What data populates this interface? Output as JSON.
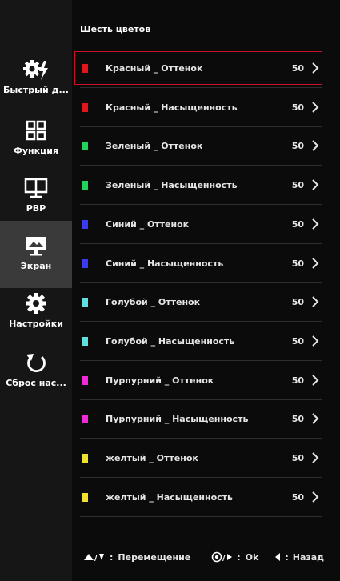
{
  "sidebar": {
    "items": [
      {
        "label": "Быстрый д...",
        "icon": "quick-settings-gear-bolt-icon"
      },
      {
        "label": "Функция",
        "icon": "grid-function-icon"
      },
      {
        "label": "PBP",
        "icon": "pbp-monitor-icon"
      },
      {
        "label": "Экран",
        "icon": "screen-monitor-icon",
        "active": true
      },
      {
        "label": "Настройки",
        "icon": "gear-icon"
      },
      {
        "label": "Сброс нас...",
        "icon": "reset-arrow-icon"
      }
    ]
  },
  "main": {
    "title": "Шесть цветов",
    "rows": [
      {
        "name": "Красный _ Оттенок",
        "value": "50",
        "color": "#e0161c",
        "selected": true
      },
      {
        "name": "Красный _ Насыщенность",
        "value": "50",
        "color": "#e0161c"
      },
      {
        "name": "Зеленый _ Оттенок",
        "value": "50",
        "color": "#22d35a"
      },
      {
        "name": "Зеленый _ Насыщенность",
        "value": "50",
        "color": "#22d35a"
      },
      {
        "name": "Синий _ Оттенок",
        "value": "50",
        "color": "#3b3bf0"
      },
      {
        "name": "Синий _ Насыщенность",
        "value": "50",
        "color": "#3b3bf0"
      },
      {
        "name": "Голубой _ Оттенок",
        "value": "50",
        "color": "#5fe0e0"
      },
      {
        "name": "Голубой _ Насыщенность",
        "value": "50",
        "color": "#5fe0e0"
      },
      {
        "name": "Пурпурний _ Оттенок",
        "value": "50",
        "color": "#f02ad8"
      },
      {
        "name": "Пурпурний _ Насыщенность",
        "value": "50",
        "color": "#f02ad8"
      },
      {
        "name": "желтый _ Оттенок",
        "value": "50",
        "color": "#f0e030"
      },
      {
        "name": "желтый _ Насыщенность",
        "value": "50",
        "color": "#f0e030"
      }
    ]
  },
  "footer": {
    "move_label": "Перемещение",
    "ok_label": "Ok",
    "back_label": "Назад",
    "sep": ":"
  },
  "colors": {
    "selection_border": "#d0102a",
    "sidebar_bg": "#161616",
    "sidebar_active_bg": "#3a3a3a",
    "main_bg": "#0b0b0b"
  }
}
